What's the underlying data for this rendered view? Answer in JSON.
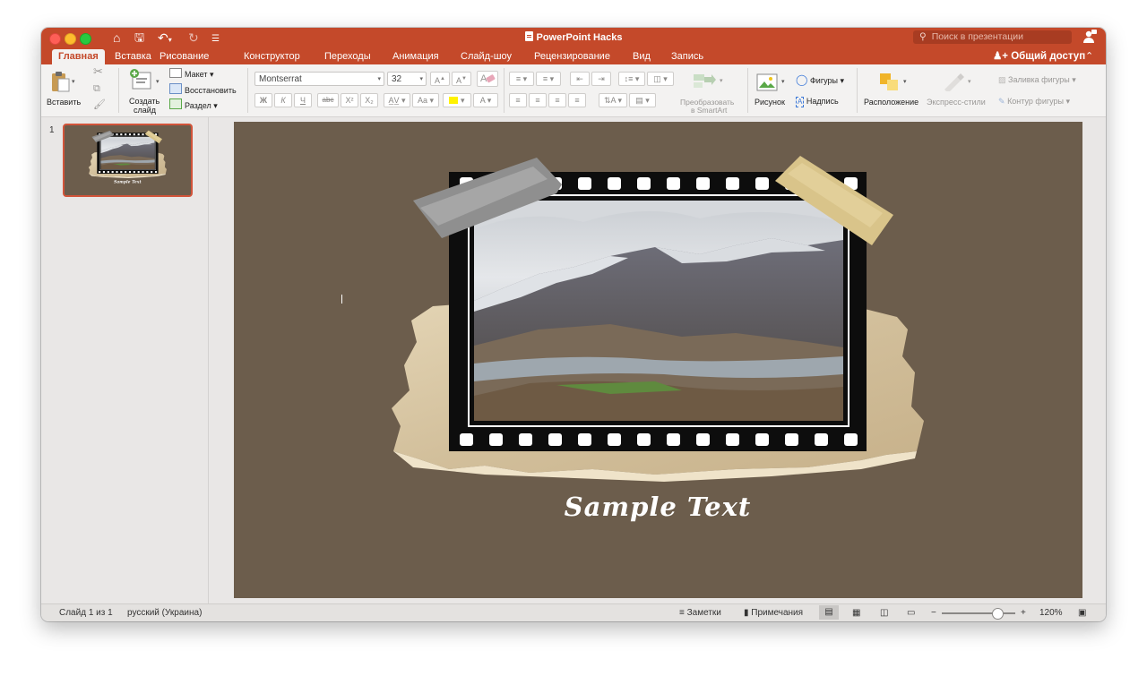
{
  "window": {
    "title": "PowerPoint Hacks",
    "search_placeholder": "Поиск в презентации"
  },
  "tabs": [
    "Главная",
    "Вставка",
    "Рисование",
    "Конструктор",
    "Переходы",
    "Анимация",
    "Слайд-шоу",
    "Рецензирование",
    "Вид",
    "Запись"
  ],
  "share": {
    "label": "Общий доступ",
    "icon": "add-person-icon"
  },
  "ribbon": {
    "paste": "Вставить",
    "new_slide_line1": "Создать",
    "new_slide_line2": "слайд",
    "layout": "Макет",
    "reset": "Восстановить",
    "section": "Раздел",
    "font_name": "Montserrat",
    "font_size": "32",
    "bold": "Ж",
    "italic": "К",
    "underline": "Ч",
    "strike": "abc",
    "superscript": "X²",
    "subscript": "X₂",
    "convert_line1": "Преобразовать",
    "convert_line2": "в SmartArt",
    "picture": "Рисунок",
    "shapes": "Фигуры",
    "textbox": "Надпись",
    "arrange": "Расположение",
    "quick_styles": "Экспресс-стили",
    "shape_fill": "Заливка фигуры",
    "shape_outline": "Контур фигуры"
  },
  "thumbnails": [
    {
      "number": "1",
      "caption": "Sample Text"
    }
  ],
  "slide": {
    "caption": "Sample Text"
  },
  "status": {
    "slide_info": "Слайд 1 из 1",
    "language": "русский (Украина)",
    "notes": "Заметки",
    "comments": "Примечания",
    "zoom_minus": "−",
    "zoom_plus": "+",
    "zoom": "120%",
    "zoom_level_percent": 120
  },
  "colors": {
    "accent": "#c4492a",
    "slide_bg": "#6c5d4c",
    "paper": "#d9c8a8",
    "film": "#0d0d0d"
  }
}
